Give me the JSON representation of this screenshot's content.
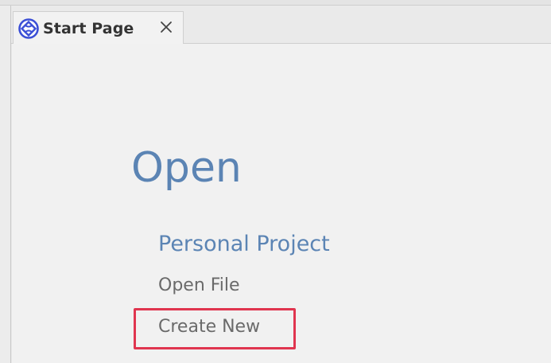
{
  "tab": {
    "label": "Start Page",
    "icon": "start-page-logo-icon",
    "close_icon": "close-icon",
    "accent_color": "#3b4fd6"
  },
  "main": {
    "section_title": "Open",
    "links": {
      "personal_project": "Personal Project",
      "open_file": "Open File",
      "create_new": "Create New"
    },
    "highlight_color": "#e0354f",
    "title_color": "#5b84b4"
  }
}
